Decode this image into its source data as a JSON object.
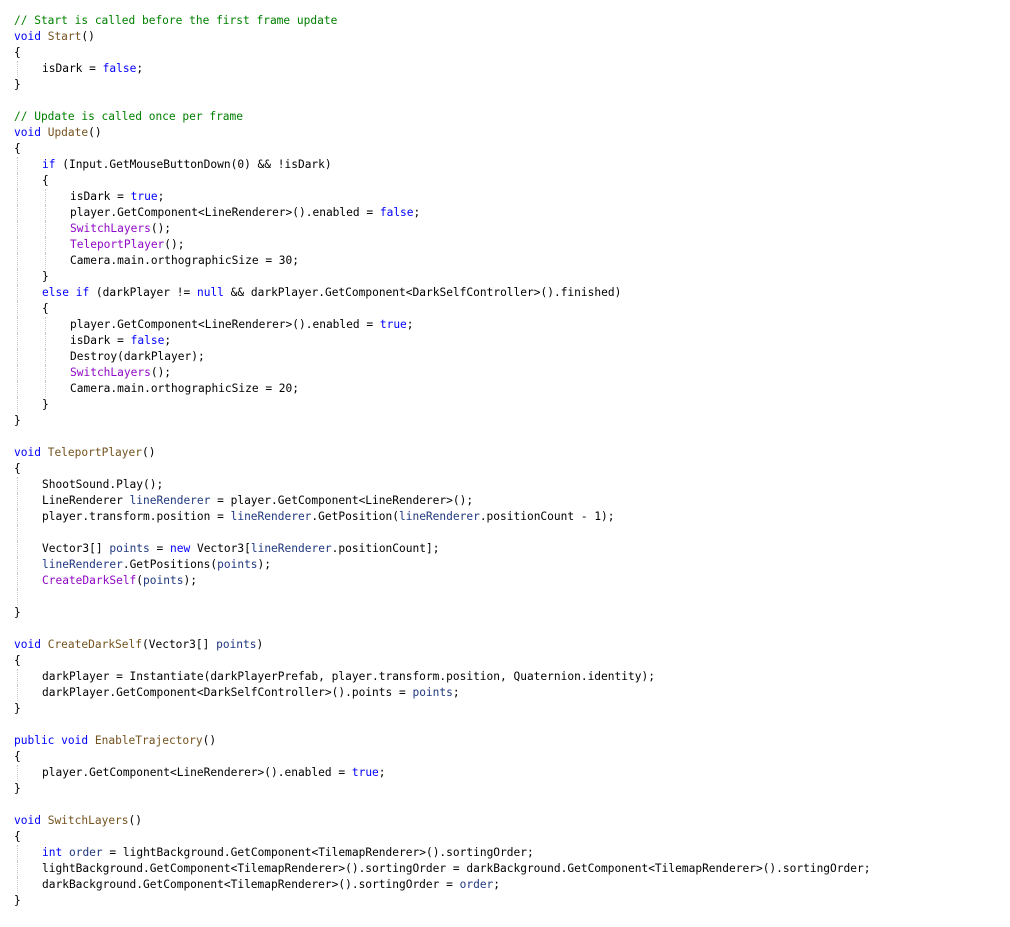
{
  "editor": {
    "background": "#ffffff",
    "colors": {
      "keyword": "#0000ff",
      "comment": "#008000",
      "method": "#74531f",
      "member_call": "#8f08c4",
      "local": "#1f377f",
      "plain": "#000000",
      "indent_guide": "#c8c8c8"
    },
    "lines": [
      {
        "indent": 0,
        "tokens": [
          {
            "t": "// Start is called before the first frame update",
            "c": "cm"
          }
        ]
      },
      {
        "indent": 0,
        "tokens": [
          {
            "t": "void",
            "c": "kw"
          },
          {
            "t": " ",
            "c": "pl"
          },
          {
            "t": "Start",
            "c": "fn"
          },
          {
            "t": "()",
            "c": "pl"
          }
        ]
      },
      {
        "indent": 0,
        "tokens": [
          {
            "t": "{",
            "c": "pl"
          }
        ]
      },
      {
        "indent": 1,
        "tokens": [
          {
            "t": "isDark = ",
            "c": "pl"
          },
          {
            "t": "false",
            "c": "kw"
          },
          {
            "t": ";",
            "c": "pl"
          }
        ]
      },
      {
        "indent": 0,
        "tokens": [
          {
            "t": "}",
            "c": "pl"
          }
        ]
      },
      {
        "indent": 0,
        "tokens": []
      },
      {
        "indent": 0,
        "tokens": [
          {
            "t": "// Update is called once per frame",
            "c": "cm"
          }
        ]
      },
      {
        "indent": 0,
        "tokens": [
          {
            "t": "void",
            "c": "kw"
          },
          {
            "t": " ",
            "c": "pl"
          },
          {
            "t": "Update",
            "c": "fn"
          },
          {
            "t": "()",
            "c": "pl"
          }
        ]
      },
      {
        "indent": 0,
        "tokens": [
          {
            "t": "{",
            "c": "pl"
          }
        ]
      },
      {
        "indent": 1,
        "tokens": [
          {
            "t": "if",
            "c": "kw"
          },
          {
            "t": " (Input.GetMouseButtonDown(0) && !isDark)",
            "c": "pl"
          }
        ]
      },
      {
        "indent": 1,
        "tokens": [
          {
            "t": "{",
            "c": "pl"
          }
        ]
      },
      {
        "indent": 2,
        "tokens": [
          {
            "t": "isDark = ",
            "c": "pl"
          },
          {
            "t": "true",
            "c": "kw"
          },
          {
            "t": ";",
            "c": "pl"
          }
        ]
      },
      {
        "indent": 2,
        "tokens": [
          {
            "t": "player.GetComponent<LineRenderer>().enabled = ",
            "c": "pl"
          },
          {
            "t": "false",
            "c": "kw"
          },
          {
            "t": ";",
            "c": "pl"
          }
        ]
      },
      {
        "indent": 2,
        "tokens": [
          {
            "t": "SwitchLayers",
            "c": "mb"
          },
          {
            "t": "();",
            "c": "pl"
          }
        ]
      },
      {
        "indent": 2,
        "tokens": [
          {
            "t": "TeleportPlayer",
            "c": "mb"
          },
          {
            "t": "();",
            "c": "pl"
          }
        ]
      },
      {
        "indent": 2,
        "tokens": [
          {
            "t": "Camera.main.orthographicSize = 30;",
            "c": "pl"
          }
        ]
      },
      {
        "indent": 1,
        "tokens": [
          {
            "t": "}",
            "c": "pl"
          }
        ]
      },
      {
        "indent": 1,
        "tokens": [
          {
            "t": "else",
            "c": "kw"
          },
          {
            "t": " ",
            "c": "pl"
          },
          {
            "t": "if",
            "c": "kw"
          },
          {
            "t": " (darkPlayer != ",
            "c": "pl"
          },
          {
            "t": "null",
            "c": "kw"
          },
          {
            "t": " && darkPlayer.GetComponent<DarkSelfController>().finished)",
            "c": "pl"
          }
        ]
      },
      {
        "indent": 1,
        "tokens": [
          {
            "t": "{",
            "c": "pl"
          }
        ]
      },
      {
        "indent": 2,
        "tokens": [
          {
            "t": "player.GetComponent<LineRenderer>().enabled = ",
            "c": "pl"
          },
          {
            "t": "true",
            "c": "kw"
          },
          {
            "t": ";",
            "c": "pl"
          }
        ]
      },
      {
        "indent": 2,
        "tokens": [
          {
            "t": "isDark = ",
            "c": "pl"
          },
          {
            "t": "false",
            "c": "kw"
          },
          {
            "t": ";",
            "c": "pl"
          }
        ]
      },
      {
        "indent": 2,
        "tokens": [
          {
            "t": "Destroy(darkPlayer);",
            "c": "pl"
          }
        ]
      },
      {
        "indent": 2,
        "tokens": [
          {
            "t": "SwitchLayers",
            "c": "mb"
          },
          {
            "t": "();",
            "c": "pl"
          }
        ]
      },
      {
        "indent": 2,
        "tokens": [
          {
            "t": "Camera.main.orthographicSize = 20;",
            "c": "pl"
          }
        ]
      },
      {
        "indent": 1,
        "tokens": [
          {
            "t": "}",
            "c": "pl"
          }
        ]
      },
      {
        "indent": 0,
        "tokens": [
          {
            "t": "}",
            "c": "pl"
          }
        ]
      },
      {
        "indent": 0,
        "tokens": []
      },
      {
        "indent": 0,
        "tokens": [
          {
            "t": "void",
            "c": "kw"
          },
          {
            "t": " ",
            "c": "pl"
          },
          {
            "t": "TeleportPlayer",
            "c": "fn"
          },
          {
            "t": "()",
            "c": "pl"
          }
        ]
      },
      {
        "indent": 0,
        "tokens": [
          {
            "t": "{",
            "c": "pl"
          }
        ]
      },
      {
        "indent": 1,
        "tokens": [
          {
            "t": "ShootSound.Play();",
            "c": "pl"
          }
        ]
      },
      {
        "indent": 1,
        "tokens": [
          {
            "t": "LineRenderer ",
            "c": "pl"
          },
          {
            "t": "lineRenderer",
            "c": "lc"
          },
          {
            "t": " = player.GetComponent<LineRenderer>();",
            "c": "pl"
          }
        ]
      },
      {
        "indent": 1,
        "tokens": [
          {
            "t": "player.transform.position = ",
            "c": "pl"
          },
          {
            "t": "lineRenderer",
            "c": "lc"
          },
          {
            "t": ".GetPosition(",
            "c": "pl"
          },
          {
            "t": "lineRenderer",
            "c": "lc"
          },
          {
            "t": ".positionCount - 1);",
            "c": "pl"
          }
        ]
      },
      {
        "indent": 1,
        "tokens": []
      },
      {
        "indent": 1,
        "tokens": [
          {
            "t": "Vector3[] ",
            "c": "pl"
          },
          {
            "t": "points",
            "c": "lc"
          },
          {
            "t": " = ",
            "c": "pl"
          },
          {
            "t": "new",
            "c": "kw"
          },
          {
            "t": " Vector3[",
            "c": "pl"
          },
          {
            "t": "lineRenderer",
            "c": "lc"
          },
          {
            "t": ".positionCount];",
            "c": "pl"
          }
        ]
      },
      {
        "indent": 1,
        "tokens": [
          {
            "t": "lineRenderer",
            "c": "lc"
          },
          {
            "t": ".GetPositions(",
            "c": "pl"
          },
          {
            "t": "points",
            "c": "lc"
          },
          {
            "t": ");",
            "c": "pl"
          }
        ]
      },
      {
        "indent": 1,
        "tokens": [
          {
            "t": "CreateDarkSelf",
            "c": "mb"
          },
          {
            "t": "(",
            "c": "pl"
          },
          {
            "t": "points",
            "c": "lc"
          },
          {
            "t": ");",
            "c": "pl"
          }
        ]
      },
      {
        "indent": 1,
        "tokens": []
      },
      {
        "indent": 0,
        "tokens": [
          {
            "t": "}",
            "c": "pl"
          }
        ]
      },
      {
        "indent": 0,
        "tokens": []
      },
      {
        "indent": 0,
        "tokens": [
          {
            "t": "void",
            "c": "kw"
          },
          {
            "t": " ",
            "c": "pl"
          },
          {
            "t": "CreateDarkSelf",
            "c": "fn"
          },
          {
            "t": "(Vector3[] ",
            "c": "pl"
          },
          {
            "t": "points",
            "c": "lc"
          },
          {
            "t": ")",
            "c": "pl"
          }
        ]
      },
      {
        "indent": 0,
        "tokens": [
          {
            "t": "{",
            "c": "pl"
          }
        ]
      },
      {
        "indent": 1,
        "tokens": [
          {
            "t": "darkPlayer = Instantiate(darkPlayerPrefab, player.transform.position, Quaternion.identity);",
            "c": "pl"
          }
        ]
      },
      {
        "indent": 1,
        "tokens": [
          {
            "t": "darkPlayer.GetComponent<DarkSelfController>().points = ",
            "c": "pl"
          },
          {
            "t": "points",
            "c": "lc"
          },
          {
            "t": ";",
            "c": "pl"
          }
        ]
      },
      {
        "indent": 0,
        "tokens": [
          {
            "t": "}",
            "c": "pl"
          }
        ]
      },
      {
        "indent": 0,
        "tokens": []
      },
      {
        "indent": 0,
        "tokens": [
          {
            "t": "public",
            "c": "kw"
          },
          {
            "t": " ",
            "c": "pl"
          },
          {
            "t": "void",
            "c": "kw"
          },
          {
            "t": " ",
            "c": "pl"
          },
          {
            "t": "EnableTrajectory",
            "c": "fn"
          },
          {
            "t": "()",
            "c": "pl"
          }
        ]
      },
      {
        "indent": 0,
        "tokens": [
          {
            "t": "{",
            "c": "pl"
          }
        ]
      },
      {
        "indent": 1,
        "tokens": [
          {
            "t": "player.GetComponent<LineRenderer>().enabled = ",
            "c": "pl"
          },
          {
            "t": "true",
            "c": "kw"
          },
          {
            "t": ";",
            "c": "pl"
          }
        ]
      },
      {
        "indent": 0,
        "tokens": [
          {
            "t": "}",
            "c": "pl"
          }
        ]
      },
      {
        "indent": 0,
        "tokens": []
      },
      {
        "indent": 0,
        "tokens": [
          {
            "t": "void",
            "c": "kw"
          },
          {
            "t": " ",
            "c": "pl"
          },
          {
            "t": "SwitchLayers",
            "c": "fn"
          },
          {
            "t": "()",
            "c": "pl"
          }
        ]
      },
      {
        "indent": 0,
        "tokens": [
          {
            "t": "{",
            "c": "pl"
          }
        ]
      },
      {
        "indent": 1,
        "tokens": [
          {
            "t": "int",
            "c": "kw"
          },
          {
            "t": " ",
            "c": "pl"
          },
          {
            "t": "order",
            "c": "lc"
          },
          {
            "t": " = lightBackground.GetComponent<TilemapRenderer>().sortingOrder;",
            "c": "pl"
          }
        ]
      },
      {
        "indent": 1,
        "tokens": [
          {
            "t": "lightBackground.GetComponent<TilemapRenderer>().sortingOrder = darkBackground.GetComponent<TilemapRenderer>().sortingOrder;",
            "c": "pl"
          }
        ]
      },
      {
        "indent": 1,
        "tokens": [
          {
            "t": "darkBackground.GetComponent<TilemapRenderer>().sortingOrder = ",
            "c": "pl"
          },
          {
            "t": "order",
            "c": "lc"
          },
          {
            "t": ";",
            "c": "pl"
          }
        ]
      },
      {
        "indent": 0,
        "tokens": [
          {
            "t": "}",
            "c": "pl"
          }
        ]
      }
    ]
  }
}
